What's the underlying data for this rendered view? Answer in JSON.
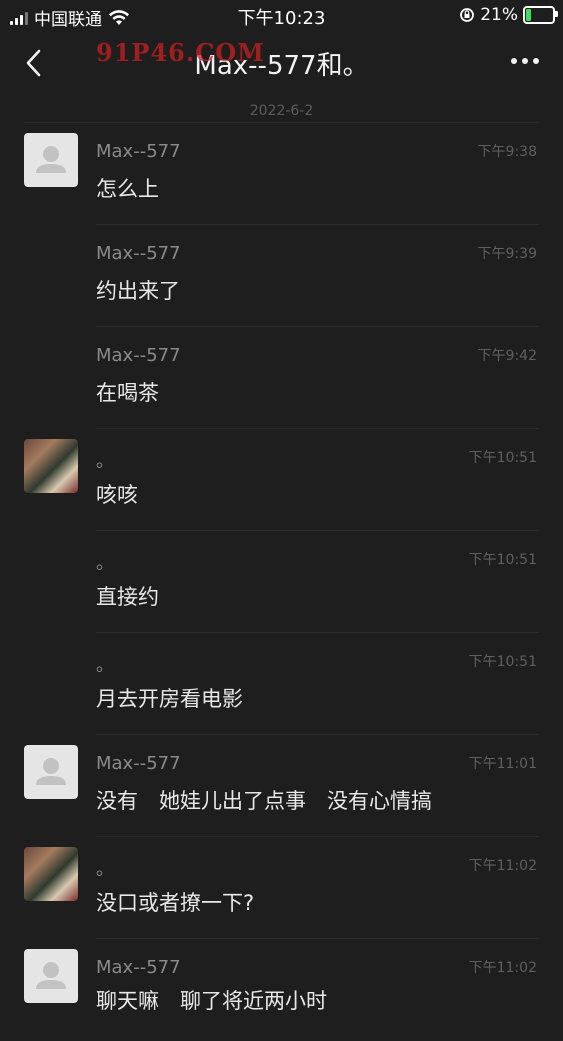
{
  "status": {
    "carrier": "中国联通",
    "time": "下午10:23",
    "battery": "21%",
    "battery_level": 0.21
  },
  "nav": {
    "title": "Max--577和。",
    "watermark": "91P46.COM"
  },
  "date": "2022-6-2",
  "messages": [
    {
      "sender": "Max--577",
      "time": "下午9:38",
      "text": "怎么上"
    },
    {
      "sender": "Max--577",
      "time": "下午9:39",
      "text": "约出来了"
    },
    {
      "sender": "Max--577",
      "time": "下午9:42",
      "text": "在喝茶"
    },
    {
      "sender": "。",
      "time": "下午10:51",
      "text": "咳咳"
    },
    {
      "sender": "。",
      "time": "下午10:51",
      "text": "直接约"
    },
    {
      "sender": "。",
      "time": "下午10:51",
      "text": "月去开房看电影"
    },
    {
      "sender": "Max--577",
      "time": "下午11:01",
      "text": "没有　她娃儿出了点事　没有心情搞"
    },
    {
      "sender": "。",
      "time": "下午11:02",
      "text": "没口或者撩一下?"
    },
    {
      "sender": "Max--577",
      "time": "下午11:02",
      "text": "聊天嘛　聊了将近两小时"
    }
  ]
}
